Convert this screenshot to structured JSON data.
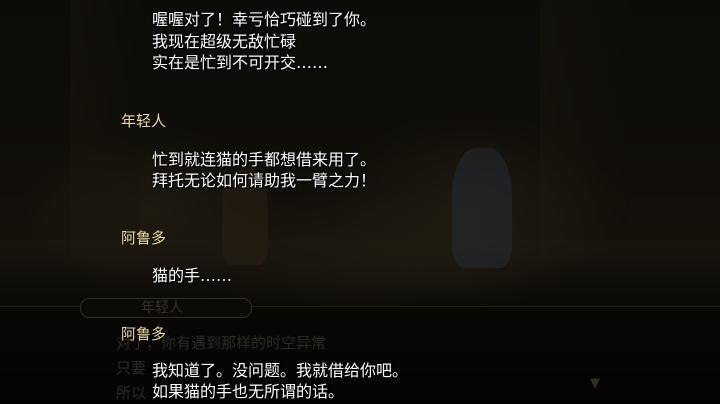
{
  "backlog": {
    "entries": [
      {
        "speaker": "",
        "lines": [
          "喔喔对了！幸亏恰巧碰到了你。",
          "我现在超级无敌忙碌",
          "实在是忙到不可开交……"
        ]
      },
      {
        "speaker": "年轻人",
        "lines": [
          "忙到就连猫的手都想借来用了。",
          "拜托无论如何请助我一臂之力！"
        ]
      },
      {
        "speaker": "阿鲁多",
        "lines": [
          "猫的手……"
        ]
      },
      {
        "speaker": "阿鲁多",
        "lines": [
          "我知道了。没问题。我就借给你吧。",
          "如果猫的手也无所谓的话。"
        ]
      }
    ]
  },
  "underlying_dialog": {
    "name": "年轻人",
    "lines": [
      "对了，你有遇到那样的时空异常",
      "只要",
      "所以"
    ],
    "next_indicator": "▼"
  },
  "colors": {
    "speaker_name": "#e9d9a2",
    "dialog_text": "#ffffff",
    "overlay": "rgba(0,0,0,0.5)"
  }
}
